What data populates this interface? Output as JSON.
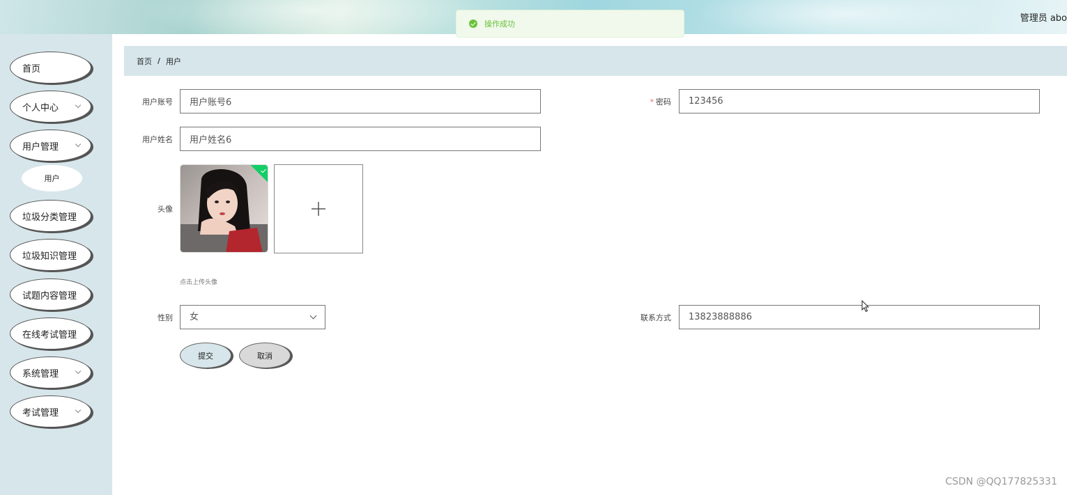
{
  "header": {
    "user_text": "管理员 abo"
  },
  "toast": {
    "message": "操作成功",
    "color": "#67c23a"
  },
  "sidebar": {
    "items": [
      {
        "label": "首页",
        "has_submenu": false
      },
      {
        "label": "个人中心",
        "has_submenu": true
      },
      {
        "label": "用户管理",
        "has_submenu": true
      },
      {
        "label": "垃圾分类管理",
        "has_submenu": false
      },
      {
        "label": "垃圾知识管理",
        "has_submenu": false
      },
      {
        "label": "试题内容管理",
        "has_submenu": false
      },
      {
        "label": "在线考试管理",
        "has_submenu": false
      },
      {
        "label": "系统管理",
        "has_submenu": true
      },
      {
        "label": "考试管理",
        "has_submenu": true
      }
    ],
    "sub_items": [
      {
        "label": "用户"
      }
    ]
  },
  "breadcrumb": {
    "home": "首页",
    "separator": "/",
    "current": "用户"
  },
  "form": {
    "account_label": "用户账号",
    "account_value": "用户账号6",
    "password_required_mark": "*",
    "password_label": "密码",
    "password_value": "123456",
    "name_label": "用户姓名",
    "name_value": "用户姓名6",
    "avatar_label": "头像",
    "upload_tip": "点击上传头像",
    "gender_label": "性别",
    "gender_value": "女",
    "contact_label": "联系方式",
    "contact_value": "13823888886"
  },
  "buttons": {
    "submit": "提交",
    "cancel": "取消"
  },
  "watermark": "CSDN @QQ177825331",
  "colors": {
    "sidebar_bg": "#d7e6eb",
    "success_badge": "#13ce66",
    "submit_bg": "#d7e6eb",
    "cancel_bg": "#d9d9d9"
  }
}
